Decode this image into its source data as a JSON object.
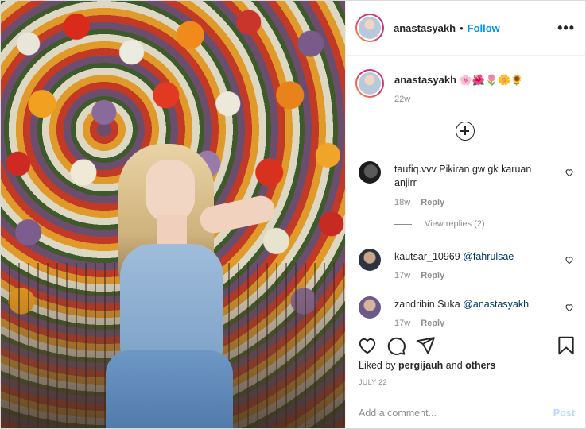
{
  "post": {
    "author": "anastasyakh",
    "follow_label": "Follow",
    "separator": "•",
    "more_label": "•••"
  },
  "caption": {
    "username": "anastasyakh",
    "text": "🌸🌺🌷🌼🌻",
    "time": "22w"
  },
  "comments": [
    {
      "username": "taufiq.vvv",
      "text": "Pikiran gw gk karuan anjirr",
      "mention": "",
      "time": "18w",
      "reply_label": "Reply",
      "view_replies": "View replies (2)"
    },
    {
      "username": "kautsar_10969",
      "text": "",
      "mention": "@fahrulsae",
      "time": "17w",
      "reply_label": "Reply"
    },
    {
      "username": "zandribin",
      "text": "Suka",
      "mention": "@anastasyakh",
      "time": "17w",
      "reply_label": "Reply"
    }
  ],
  "likes": {
    "prefix": "Liked by",
    "user": "pergijauh",
    "connector": "and",
    "others": "others"
  },
  "date": "JULY 22",
  "add_comment": {
    "placeholder": "Add a comment...",
    "post_label": "Post"
  },
  "icons": [
    "heart-icon",
    "comment-icon",
    "share-icon",
    "bookmark-icon",
    "plus-circle-icon",
    "more-icon"
  ],
  "colors": {
    "link": "#0095f6",
    "mention": "#00376b",
    "muted": "#8e8e8e",
    "post_disabled": "#b3dbff"
  }
}
